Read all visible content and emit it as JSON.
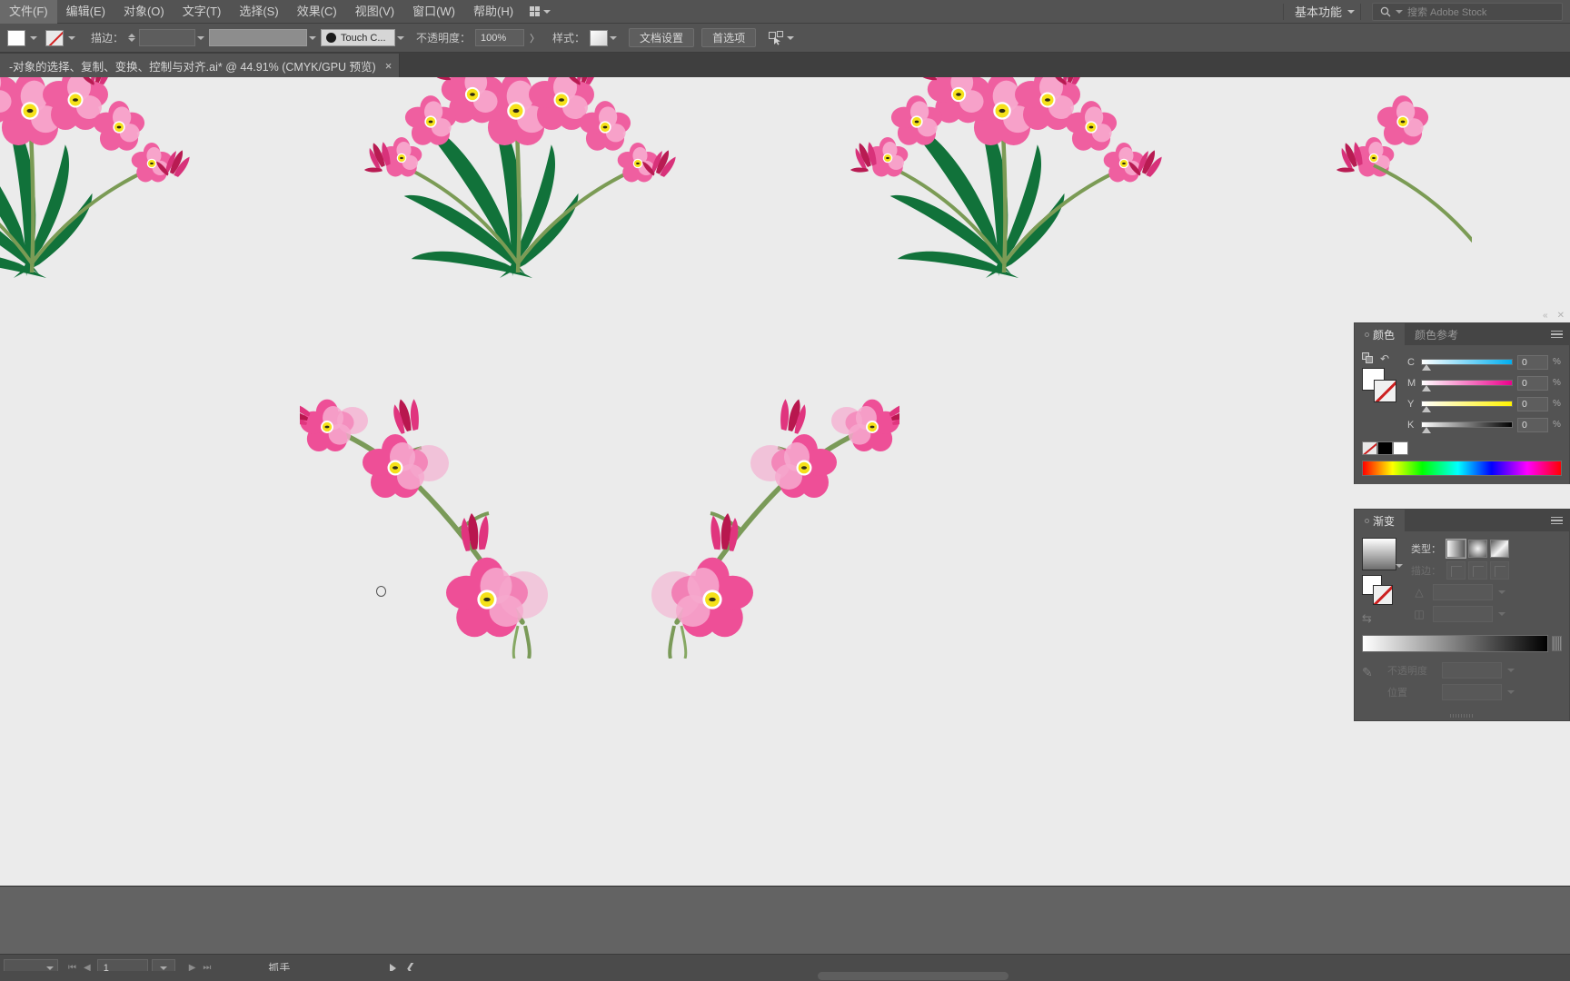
{
  "menu": {
    "items": [
      {
        "label": "文件(F)"
      },
      {
        "label": "编辑(E)"
      },
      {
        "label": "对象(O)"
      },
      {
        "label": "文字(T)"
      },
      {
        "label": "选择(S)"
      },
      {
        "label": "效果(C)"
      },
      {
        "label": "视图(V)"
      },
      {
        "label": "窗口(W)"
      },
      {
        "label": "帮助(H)"
      }
    ],
    "workspace": "基本功能",
    "search_placeholder": "搜索 Adobe Stock"
  },
  "control_bar": {
    "stroke_label": "描边：",
    "stroke_weight": "",
    "stroke_profile": "",
    "brush_label": "Touch C...",
    "opacity_label": "不透明度：",
    "opacity_value": "100%",
    "style_label": "样式：",
    "document_setup_button": "文档设置",
    "preferences_button": "首选项"
  },
  "document": {
    "tab_title": "-对象的选择、复制、变换、控制与对齐.ai* @ 44.91% (CMYK/GPU 预览)",
    "close_glyph": "×"
  },
  "color_panel": {
    "tabs": [
      {
        "label": "颜色",
        "active": true
      },
      {
        "label": "颜色参考",
        "active": false
      }
    ],
    "sliders": [
      {
        "label": "C",
        "value": "0",
        "unit": "%",
        "color": "#00aeef"
      },
      {
        "label": "M",
        "value": "0",
        "unit": "%",
        "color": "#ec008c"
      },
      {
        "label": "Y",
        "value": "0",
        "unit": "%",
        "color": "#fff200"
      },
      {
        "label": "K",
        "value": "0",
        "unit": "%",
        "color": "#000000"
      }
    ]
  },
  "gradient_panel": {
    "tab": "渐变",
    "type_label": "类型：",
    "stroke_label": "描边：",
    "angle_label": "",
    "angle_value": "",
    "aspect_value": "",
    "opacity_label": "不透明度",
    "position_label": "位置",
    "opacity_value": "",
    "position_value": ""
  },
  "status_bar": {
    "zoom_value": "",
    "page_value": "1",
    "tool_name": "抓手"
  },
  "colors": {
    "canvas": "#ebebeb",
    "chrome": "#535353",
    "panel_header": "#454545",
    "text": "#d3d3d3",
    "flower_pink": "#e8468f",
    "flower_light_pink": "#f4a0c4",
    "leaf_green": "#0f7a3c",
    "flower_center": "#f5e11a"
  }
}
